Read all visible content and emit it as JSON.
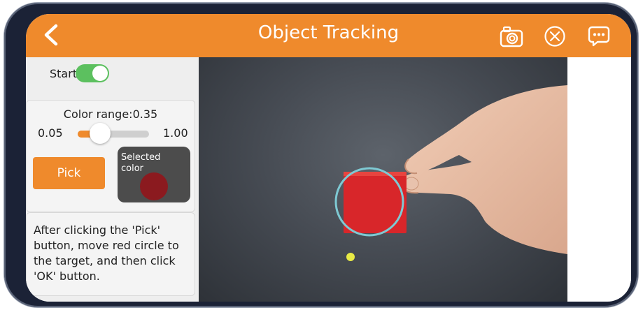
{
  "header": {
    "title": "Object Tracking",
    "back_icon": "chevron-left-icon",
    "camera_icon": "camera-icon",
    "close_icon": "close-circle-icon",
    "chat_icon": "chat-bubble-icon"
  },
  "controls": {
    "start_label": "Start",
    "start_enabled": true,
    "color_range_label": "Color range:0.35",
    "range_min": "0.05",
    "range_max": "1.00",
    "range_value": 0.35,
    "pick_label": "Pick",
    "selected_color_label": "Selected color",
    "selected_color": "#8b1a1f"
  },
  "instructions": "After clicking the 'Pick' button, move red circle to the target, and then click 'OK' button.",
  "colors": {
    "accent": "#ef8a2c",
    "toggle_on": "#5cc05f",
    "tracking_circle": "#7ec9d3",
    "target_dot": "#e8ea45",
    "object": "#d8262a"
  }
}
